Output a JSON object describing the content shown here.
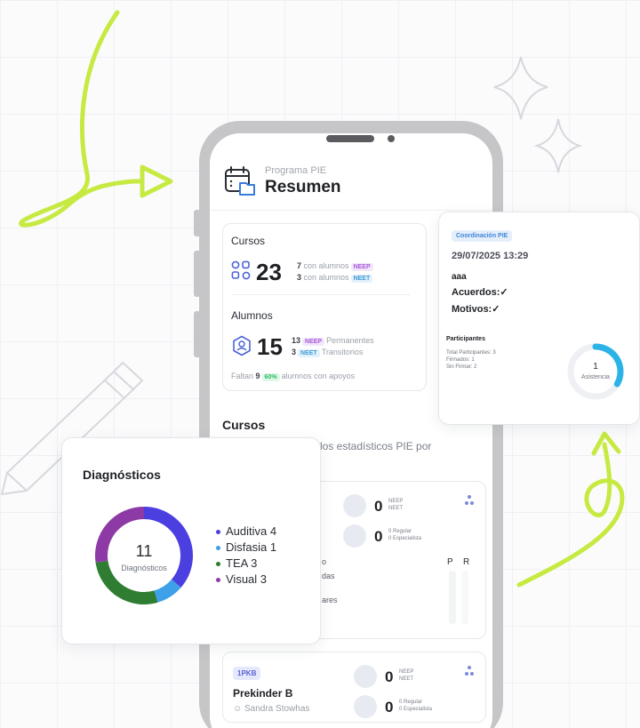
{
  "header": {
    "subtitle": "Programa PIE",
    "title": "Resumen"
  },
  "stats": {
    "cursos_label": "Cursos",
    "cursos_count": "23",
    "cursos_neep_num": "7",
    "cursos_neep_text": "con alumnos",
    "cursos_neep_tag": "NEEP",
    "cursos_neet_num": "3",
    "cursos_neet_text": "con alumnos",
    "cursos_neet_tag": "NEET",
    "alumnos_label": "Alumnos",
    "alumnos_count": "15",
    "alumnos_neep_num": "13",
    "alumnos_neep_tag": "NEEP",
    "alumnos_neep_text": "Permanentes",
    "alumnos_neet_num": "3",
    "alumnos_neet_tag": "NEET",
    "alumnos_neet_text": "Transitorios",
    "faltan_prefix": "Faltan",
    "faltan_num": "9",
    "faltan_pct": "60%",
    "faltan_suffix": "alumnos con apoyos"
  },
  "cursos_section": {
    "title": "Cursos",
    "description": "los estadísticos PIE por"
  },
  "course_card_1": {
    "zero1": "0",
    "neep": "NEEP",
    "neet": "NEET",
    "zero2": "0",
    "regular": "0 Regular",
    "especialista": "0 Especialista",
    "col_p": "P",
    "col_r": "R",
    "frag1": "o",
    "frag2": "das",
    "frag3": "ares"
  },
  "course_card_2": {
    "badge": "1PKB",
    "name": "Prekinder B",
    "teacher": "Sandra Stowhas",
    "zero1": "0",
    "neep": "NEEP",
    "neet": "NEET",
    "zero2": "0",
    "regular": "0 Regular",
    "especialista": "0 Especialista"
  },
  "diagnosticos": {
    "title": "Diagnósticos",
    "total": "11",
    "total_label": "Diagnósticos",
    "legend": [
      {
        "label": "Auditiva 4",
        "value": 4,
        "color": "#4b3fe0"
      },
      {
        "label": "Disfasia 1",
        "value": 1,
        "color": "#3ea0e8"
      },
      {
        "label": "TEA 3",
        "value": 3,
        "color": "#2e7d32"
      },
      {
        "label": "Visual 3",
        "value": 3,
        "color": "#8e3aa6"
      }
    ]
  },
  "coordinacion": {
    "badge": "Coordinación PIE",
    "datetime": "29/07/2025 13:29",
    "text": "aaa",
    "acuerdos": "Acuerdos:",
    "motivos": "Motivos:",
    "participantes_title": "Participantes",
    "total_participantes": "Total Participantes: 3",
    "firmados": "Firmados: 1",
    "sin_firmar": "Sin Firmar: 2",
    "asistencia_value": "1",
    "asistencia_label": "Asistencia",
    "asistencia_fraction": 0.3333
  },
  "colors": {
    "accent_green_doodle": "#c6ea42",
    "phone_frame": "#c6c6c8",
    "neep": "#a95bd9",
    "neet": "#3f9bd5",
    "asistencia_ring": "#2bb3e8"
  },
  "icons": [
    "calendar-folder-icon",
    "grid-icon",
    "person-badge-icon",
    "person-icon",
    "node-icon",
    "check-icon"
  ]
}
